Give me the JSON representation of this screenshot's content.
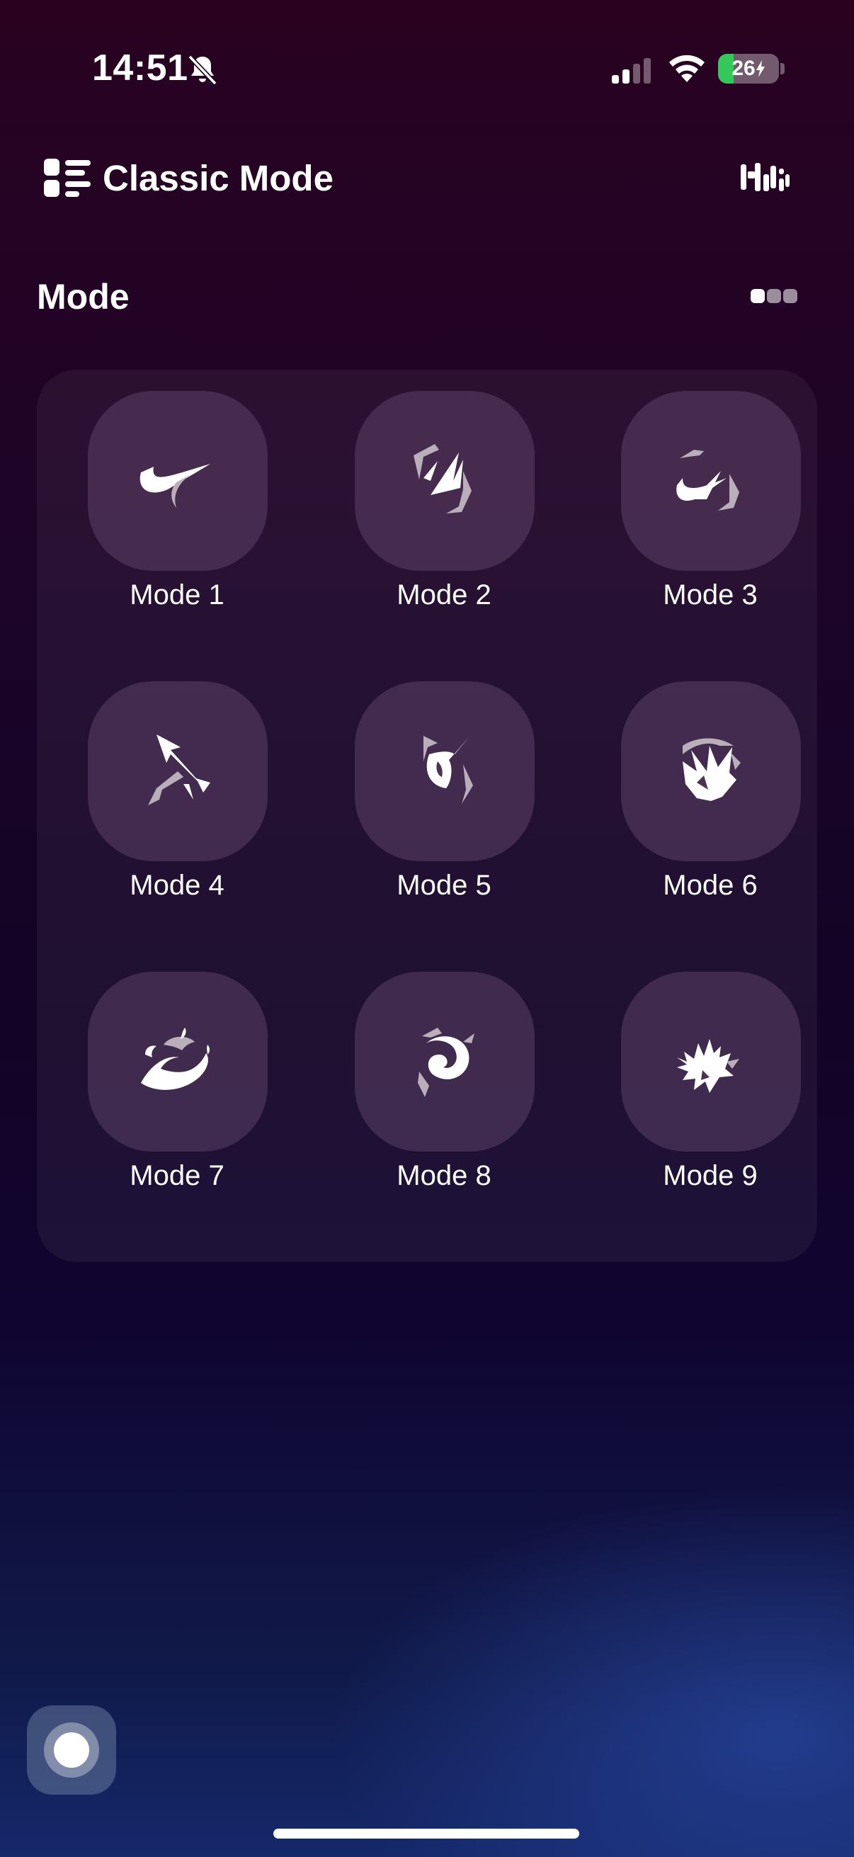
{
  "status_bar": {
    "time": "14:51",
    "battery_level": "26",
    "battery_fraction": 0.26,
    "icons": [
      "bell-slash-icon",
      "cellular-signal-icon",
      "wifi-icon",
      "battery-charging-icon"
    ]
  },
  "header": {
    "title": "Classic Mode",
    "left_icon": "list-menu-icon",
    "right_icon": "brand-logo-icon"
  },
  "section": {
    "title": "Mode",
    "page_indicator_icon": "page-dots-icon"
  },
  "modes": [
    {
      "label": "Mode 1",
      "icon": "mode-1-icon"
    },
    {
      "label": "Mode 2",
      "icon": "mode-2-icon"
    },
    {
      "label": "Mode 3",
      "icon": "mode-3-icon"
    },
    {
      "label": "Mode 4",
      "icon": "mode-4-icon"
    },
    {
      "label": "Mode 5",
      "icon": "mode-5-icon"
    },
    {
      "label": "Mode 6",
      "icon": "mode-6-icon"
    },
    {
      "label": "Mode 7",
      "icon": "mode-7-icon"
    },
    {
      "label": "Mode 8",
      "icon": "mode-8-icon"
    },
    {
      "label": "Mode 9",
      "icon": "mode-9-icon"
    }
  ],
  "colors": {
    "tile_background": "#4a3450",
    "icon_primary": "#ffffff",
    "icon_secondary": "#b9aeb9",
    "battery_green": "#34c759"
  }
}
